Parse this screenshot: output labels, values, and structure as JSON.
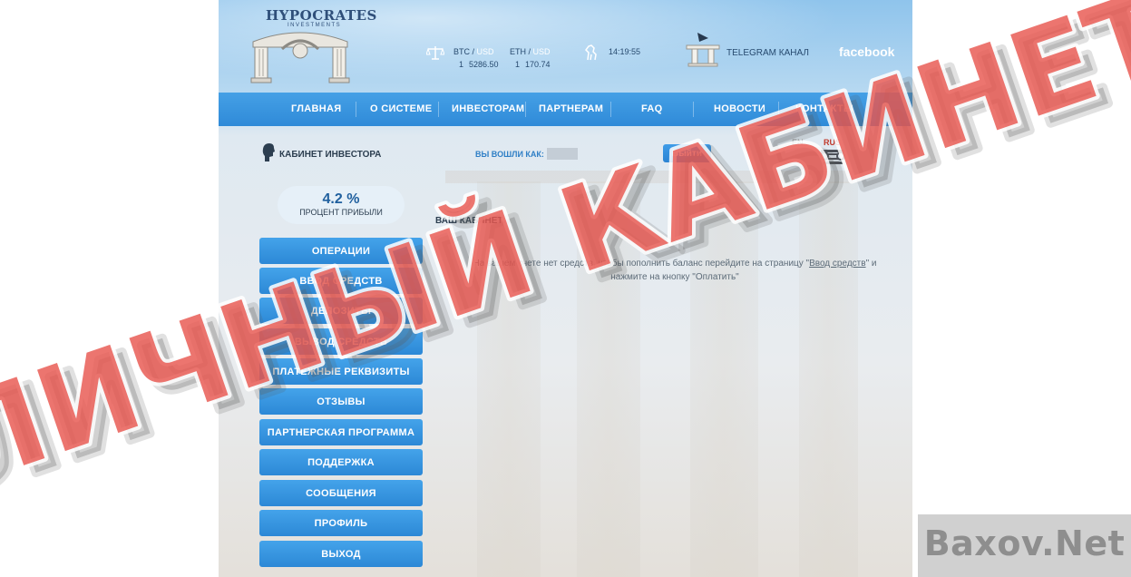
{
  "brand": {
    "name": "HYPOCRATES",
    "tagline": "INVESTMENTS"
  },
  "rates": {
    "btc": {
      "label": "BTC",
      "currency": "USD",
      "amount": "1",
      "value": "5286.50"
    },
    "eth": {
      "label": "ETH",
      "currency": "USD",
      "amount": "1",
      "value": "170.74"
    },
    "time": "14:19:55"
  },
  "social": {
    "telegram": "TELEGRAM КАНАЛ",
    "facebook": "facebook"
  },
  "nav": [
    "ГЛАВНАЯ",
    "О СИСТЕМЕ",
    "ИНВЕСТОРАМ",
    "ПАРТНЕРАМ",
    "FAQ",
    "НОВОСТИ",
    "КОНТАКТЫ"
  ],
  "cabinet": {
    "title": "КАБИНЕТ ИНВЕСТОРА",
    "logged_in_label": "ВЫ ВОШЛИ КАК:",
    "logout": "Выйти",
    "languages": [
      "EN",
      "RUS"
    ]
  },
  "profit": {
    "value": "4.2 %",
    "label": "ПРОЦЕНТ ПРИБЫЛИ"
  },
  "menu": [
    "ОПЕРАЦИИ",
    "ВВОД СРЕДСТВ",
    "ДЕПОЗИТЫ",
    "ВЫВОД СРЕДСТВ",
    "ПЛАТЕЖНЫЕ РЕКВИЗИТЫ",
    "ОТЗЫВЫ",
    "ПАРТНЕРСКАЯ ПРОГРАММА",
    "ПОДДЕРЖКА",
    "СООБЩЕНИЯ",
    "ПРОФИЛЬ",
    "ВЫХОД"
  ],
  "main": {
    "heading": "ВАШ КАБИНЕТ:",
    "notice_start": "На вашем счете нет средств, чтобы пополнить баланс перейдите на страницу \"",
    "notice_link": "Ввод средств",
    "notice_end": "\" и нажмите на кнопку \"Оплатить\""
  },
  "overlay": {
    "stamp": "ЛИЧНЫЙ КАБИНЕТ",
    "stamp_color": "#e8574f",
    "watermark": "Baxov.Net"
  },
  "colors": {
    "nav": "#3595de",
    "button": "#3a96e3",
    "title": "#2c3e50"
  }
}
